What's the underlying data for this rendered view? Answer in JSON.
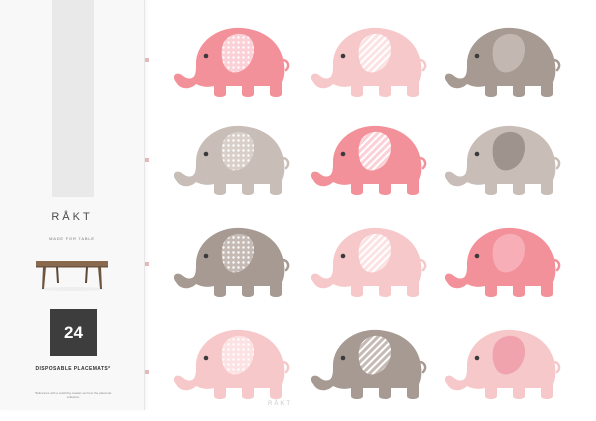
{
  "package": {
    "brand": "RÅKT",
    "tagline": "MADE FOR TABLE",
    "count": "24",
    "product": "DISPOSABLE PLACEMATS*",
    "footnote": "*Enhances with a matching coaster set from the placemat collection"
  },
  "footer": {
    "brand": "RÅKT"
  },
  "colors": {
    "pink": "#f3919a",
    "light_pink": "#f6c8c9",
    "taupe": "#a69a92",
    "light_taupe": "#c8bdb7",
    "dark_panel": "#3d3d3d"
  },
  "elephants": [
    {
      "body": "pink",
      "ear": "dots"
    },
    {
      "body": "light_pink",
      "ear": "stripes"
    },
    {
      "body": "taupe",
      "ear": "solid"
    },
    {
      "body": "light_taupe",
      "ear": "dots"
    },
    {
      "body": "pink",
      "ear": "stripes"
    },
    {
      "body": "light_taupe",
      "ear": "solid"
    },
    {
      "body": "taupe",
      "ear": "dots"
    },
    {
      "body": "light_pink",
      "ear": "stripes"
    },
    {
      "body": "pink",
      "ear": "solid"
    },
    {
      "body": "light_pink",
      "ear": "dots"
    },
    {
      "body": "taupe",
      "ear": "stripes"
    },
    {
      "body": "light_pink",
      "ear": "solid"
    }
  ]
}
